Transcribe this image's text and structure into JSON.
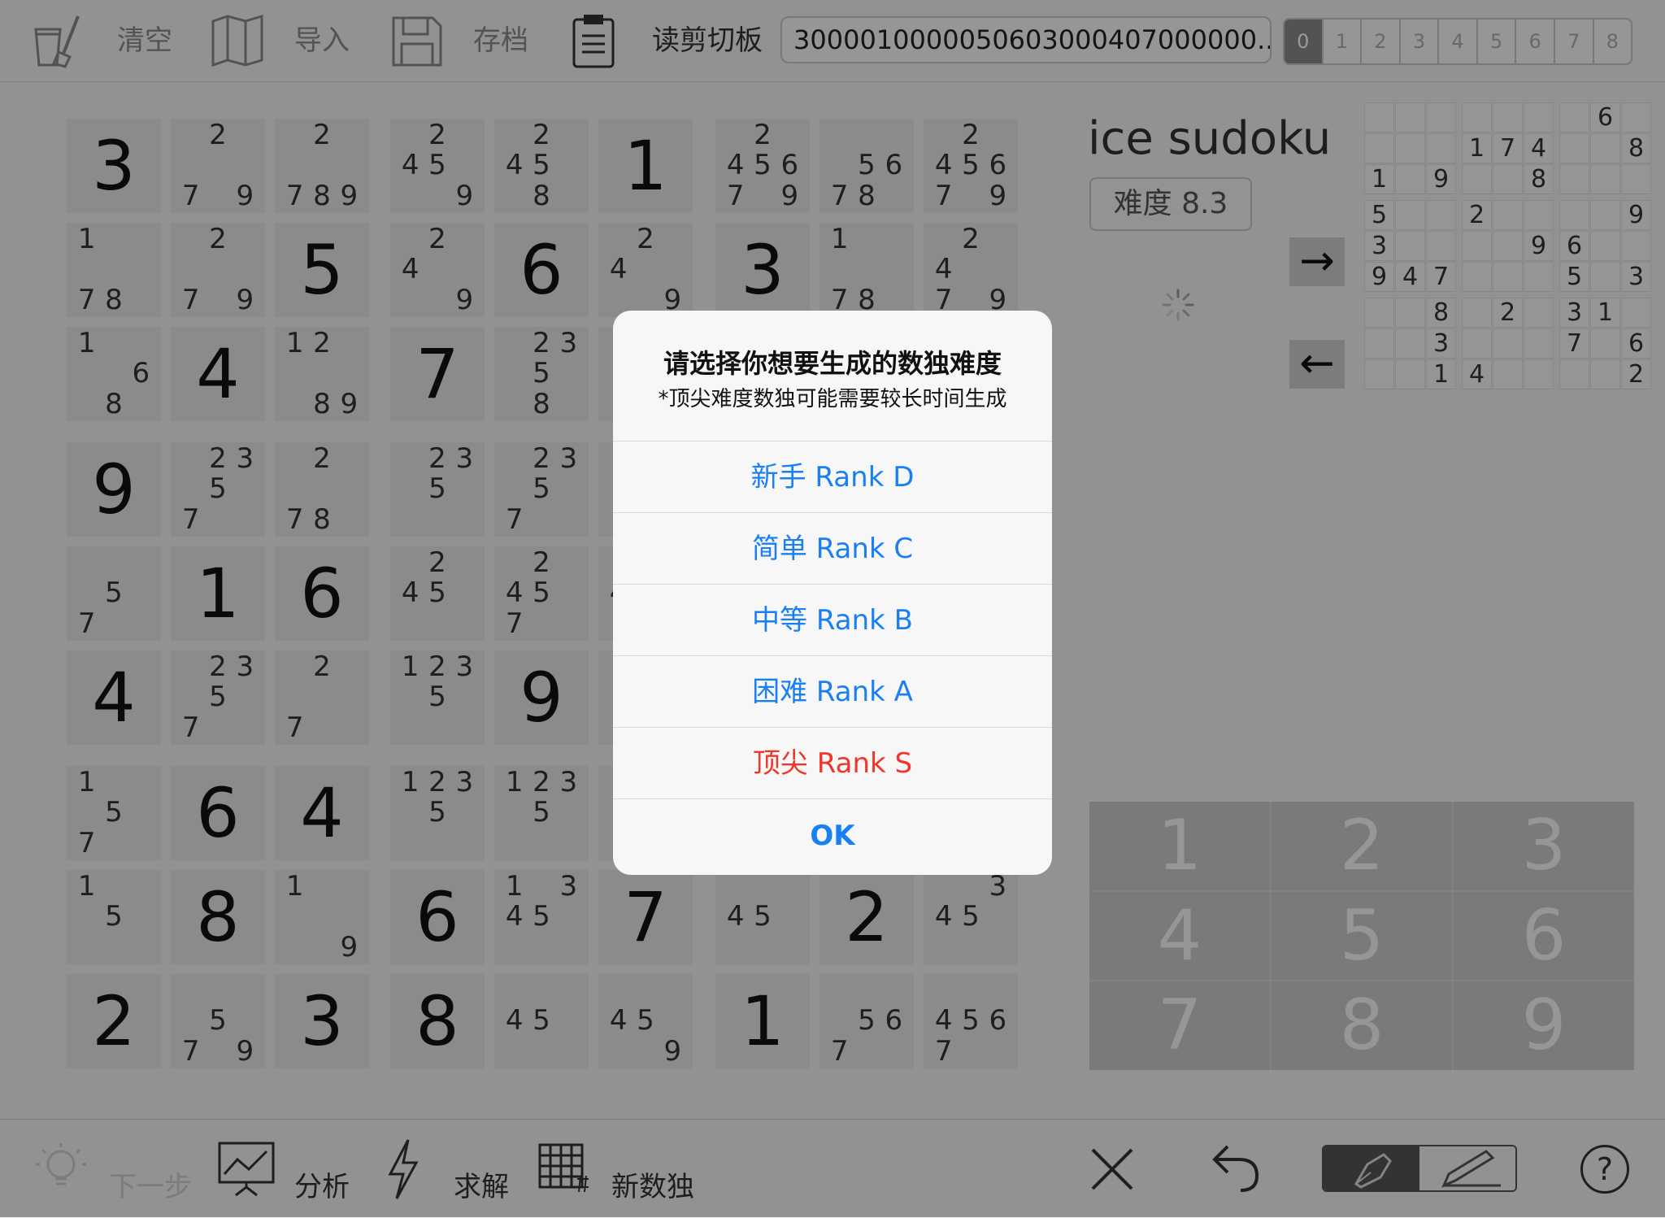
{
  "toolbar": {
    "clear_label": "清空",
    "import_label": "导入",
    "save_label": "存档",
    "read_clipboard_label": "读剪切板",
    "clipboard_value": "3000010000050603000407000000...",
    "digit_filter": [
      "0",
      "1",
      "2",
      "3",
      "4",
      "5",
      "6",
      "7",
      "8"
    ],
    "digit_filter_selected": "0"
  },
  "board": {
    "rows": [
      [
        {
          "v": "3"
        },
        {
          "c": [
            "",
            "2",
            "",
            "",
            "",
            "",
            "7",
            "",
            "9"
          ]
        },
        {
          "c": [
            "",
            "2",
            "",
            "",
            "",
            "",
            "7",
            "8",
            "9"
          ]
        },
        {
          "c": [
            "",
            "2",
            "",
            "4",
            "5",
            "",
            "",
            "",
            "9"
          ]
        },
        {
          "c": [
            "",
            "2",
            "",
            "4",
            "5",
            "",
            "",
            "8",
            ""
          ]
        },
        {
          "v": "1"
        },
        {
          "c": [
            "",
            "2",
            "",
            "4",
            "5",
            "6",
            "7",
            "",
            "9"
          ]
        },
        {
          "c": [
            "",
            "",
            "",
            "",
            "5",
            "6",
            "7",
            "8",
            ""
          ]
        },
        {
          "c": [
            "",
            "2",
            "",
            "4",
            "5",
            "6",
            "7",
            "",
            "9"
          ]
        }
      ],
      [
        {
          "c": [
            "1",
            "",
            "",
            "",
            "",
            "",
            "7",
            "8",
            ""
          ]
        },
        {
          "c": [
            "",
            "2",
            "",
            "",
            "",
            "",
            "7",
            "",
            "9"
          ]
        },
        {
          "v": "5"
        },
        {
          "c": [
            "",
            "2",
            "",
            "4",
            "",
            "",
            "",
            "",
            "9"
          ]
        },
        {
          "v": "6"
        },
        {
          "c": [
            "",
            "2",
            "",
            "4",
            "",
            "",
            "",
            "",
            "9"
          ]
        },
        {
          "v": "3"
        },
        {
          "c": [
            "1",
            "",
            "",
            "",
            "",
            "",
            "7",
            "8",
            ""
          ]
        },
        {
          "c": [
            "",
            "2",
            "",
            "4",
            "",
            "",
            "7",
            "",
            "9"
          ]
        }
      ],
      [
        {
          "c": [
            "1",
            "",
            "",
            "",
            "",
            "6",
            "",
            "8",
            ""
          ]
        },
        {
          "v": "4"
        },
        {
          "c": [
            "1",
            "2",
            "",
            "",
            "",
            "",
            "",
            "8",
            "9"
          ]
        },
        {
          "v": "7"
        },
        {
          "c": [
            "",
            "2",
            "3",
            "",
            "5",
            "",
            "",
            "8",
            ""
          ]
        },
        {
          "c": [
            "",
            "",
            "",
            "",
            "",
            "",
            "",
            "",
            ""
          ]
        },
        {
          "c": [
            "",
            "",
            "",
            "",
            "",
            "",
            "",
            "",
            ""
          ]
        },
        {
          "c": [
            "",
            "",
            "",
            "",
            "",
            "",
            "",
            "",
            ""
          ]
        },
        {
          "c": [
            "",
            "",
            "",
            "",
            "",
            "",
            "",
            "",
            ""
          ]
        }
      ],
      [
        {
          "v": "9"
        },
        {
          "c": [
            "",
            "2",
            "3",
            "",
            "5",
            "",
            "7",
            "",
            ""
          ]
        },
        {
          "c": [
            "",
            "2",
            "",
            "",
            "",
            "",
            "7",
            "8",
            ""
          ]
        },
        {
          "c": [
            "",
            "2",
            "3",
            "",
            "5",
            "",
            "",
            "",
            ""
          ]
        },
        {
          "c": [
            "",
            "2",
            "3",
            "",
            "5",
            "",
            "7",
            "",
            ""
          ]
        },
        {
          "c": [
            "",
            "",
            "",
            "",
            "",
            "",
            "",
            "",
            ""
          ]
        },
        {
          "c": [
            "",
            "",
            "",
            "",
            "",
            "",
            "",
            "",
            ""
          ]
        },
        {
          "c": [
            "",
            "",
            "",
            "",
            "",
            "",
            "",
            "",
            ""
          ]
        },
        {
          "c": [
            "",
            "",
            "",
            "",
            "",
            "",
            "",
            "",
            ""
          ]
        }
      ],
      [
        {
          "c": [
            "",
            "",
            "",
            "",
            "5",
            "",
            "7",
            "",
            ""
          ]
        },
        {
          "v": "1"
        },
        {
          "v": "6"
        },
        {
          "c": [
            "",
            "2",
            "",
            "4",
            "5",
            "",
            "",
            "",
            ""
          ]
        },
        {
          "c": [
            "",
            "2",
            "",
            "4",
            "5",
            "",
            "7",
            "",
            ""
          ]
        },
        {
          "c": [
            "",
            "",
            "",
            "4",
            "",
            "",
            "",
            "",
            ""
          ]
        },
        {
          "c": [
            "",
            "",
            "",
            "",
            "",
            "",
            "",
            "",
            ""
          ]
        },
        {
          "c": [
            "",
            "",
            "",
            "",
            "",
            "",
            "",
            "",
            ""
          ]
        },
        {
          "c": [
            "",
            "",
            "",
            "",
            "",
            "",
            "",
            "",
            ""
          ]
        }
      ],
      [
        {
          "v": "4"
        },
        {
          "c": [
            "",
            "2",
            "3",
            "",
            "5",
            "",
            "7",
            "",
            ""
          ]
        },
        {
          "c": [
            "",
            "2",
            "",
            "",
            "",
            "",
            "7",
            "",
            ""
          ]
        },
        {
          "c": [
            "1",
            "2",
            "3",
            "",
            "5",
            "",
            "",
            "",
            ""
          ]
        },
        {
          "v": "9"
        },
        {
          "c": [
            "",
            "",
            "",
            "",
            "",
            "",
            "",
            "",
            ""
          ]
        },
        {
          "c": [
            "",
            "",
            "",
            "",
            "",
            "",
            "",
            "",
            ""
          ]
        },
        {
          "c": [
            "",
            "",
            "",
            "",
            "",
            "",
            "",
            "",
            ""
          ]
        },
        {
          "c": [
            "",
            "",
            "",
            "",
            "",
            "",
            "",
            "",
            ""
          ]
        }
      ],
      [
        {
          "c": [
            "1",
            "",
            "",
            "",
            "5",
            "",
            "7",
            "",
            ""
          ]
        },
        {
          "v": "6"
        },
        {
          "v": "4"
        },
        {
          "c": [
            "1",
            "2",
            "3",
            "",
            "5",
            "",
            "",
            "",
            ""
          ]
        },
        {
          "c": [
            "1",
            "2",
            "3",
            "",
            "5",
            "",
            "",
            "",
            ""
          ]
        },
        {
          "c": [
            "",
            "",
            "",
            "",
            "",
            "",
            "",
            "",
            ""
          ]
        },
        {
          "c": [
            "",
            "",
            "",
            "",
            "",
            "",
            "",
            "",
            ""
          ]
        },
        {
          "c": [
            "",
            "",
            "",
            "",
            "",
            "",
            "",
            "",
            ""
          ]
        },
        {
          "c": [
            "",
            "",
            "",
            "",
            "",
            "",
            "",
            "",
            ""
          ]
        }
      ],
      [
        {
          "c": [
            "1",
            "",
            "",
            "",
            "5",
            "",
            "",
            "",
            ""
          ]
        },
        {
          "v": "8"
        },
        {
          "c": [
            "1",
            "",
            "",
            "",
            "",
            "",
            "",
            "",
            "9"
          ]
        },
        {
          "v": "6"
        },
        {
          "c": [
            "1",
            "",
            "3",
            "4",
            "5",
            "",
            "",
            "",
            ""
          ]
        },
        {
          "v": "7"
        },
        {
          "c": [
            "",
            "",
            "",
            "4",
            "5",
            "",
            "",
            "",
            ""
          ]
        },
        {
          "v": "2"
        },
        {
          "c": [
            "",
            "",
            "3",
            "4",
            "5",
            "",
            "",
            "",
            ""
          ]
        }
      ],
      [
        {
          "v": "2"
        },
        {
          "c": [
            "",
            "",
            "",
            "",
            "5",
            "",
            "7",
            "",
            "9"
          ]
        },
        {
          "v": "3"
        },
        {
          "v": "8"
        },
        {
          "c": [
            "",
            "",
            "",
            "4",
            "5",
            "",
            "",
            "",
            ""
          ]
        },
        {
          "c": [
            "",
            "",
            "",
            "4",
            "5",
            "",
            "",
            "",
            "9"
          ]
        },
        {
          "v": "1"
        },
        {
          "c": [
            "",
            "",
            "",
            "",
            "5",
            "6",
            "7",
            "",
            ""
          ]
        },
        {
          "c": [
            "",
            "",
            "",
            "4",
            "5",
            "6",
            "7",
            "",
            ""
          ]
        }
      ]
    ]
  },
  "side": {
    "app_title": "ice sudoku",
    "difficulty": "难度 8.3",
    "next_arrow": "→",
    "prev_arrow": "←",
    "mini_board": [
      [
        "",
        "",
        "",
        "",
        "",
        "",
        "",
        "6",
        ""
      ],
      [
        "",
        "",
        "",
        "1",
        "7",
        "4",
        "",
        "",
        "8"
      ],
      [
        "1",
        "",
        "9",
        "",
        "",
        "8",
        "",
        "",
        ""
      ],
      [
        "5",
        "",
        "",
        "2",
        "",
        "",
        "",
        "",
        "9"
      ],
      [
        "3",
        "",
        "",
        "",
        "",
        "9",
        "6",
        "",
        ""
      ],
      [
        "9",
        "4",
        "7",
        "",
        "",
        "",
        "5",
        "",
        "3"
      ],
      [
        "",
        "",
        "8",
        "",
        "2",
        "",
        "3",
        "1",
        ""
      ],
      [
        "",
        "",
        "3",
        "",
        "",
        "",
        "7",
        "",
        "6"
      ],
      [
        "",
        "",
        "1",
        "4",
        "",
        "",
        "",
        "",
        "2"
      ]
    ]
  },
  "keypad": [
    "1",
    "2",
    "3",
    "4",
    "5",
    "6",
    "7",
    "8",
    "9"
  ],
  "bottombar": {
    "next_step_label": "下一步",
    "analyze_label": "分析",
    "solve_label": "求解",
    "new_sudoku_label": "新数独"
  },
  "dialog": {
    "title": "请选择你想要生成的数独难度",
    "message": "*顶尖难度数独可能需要较长时间生成",
    "options": [
      {
        "label": "新手  Rank D"
      },
      {
        "label": "简单  Rank C"
      },
      {
        "label": "中等  Rank B"
      },
      {
        "label": "困难  Rank A"
      },
      {
        "label": "顶尖  Rank S"
      }
    ],
    "ok_label": "OK"
  },
  "colors": {
    "accent_blue": "#1a7ff2",
    "danger_red": "#f0352b",
    "overlay": "rgba(0,0,0,0.40)"
  }
}
